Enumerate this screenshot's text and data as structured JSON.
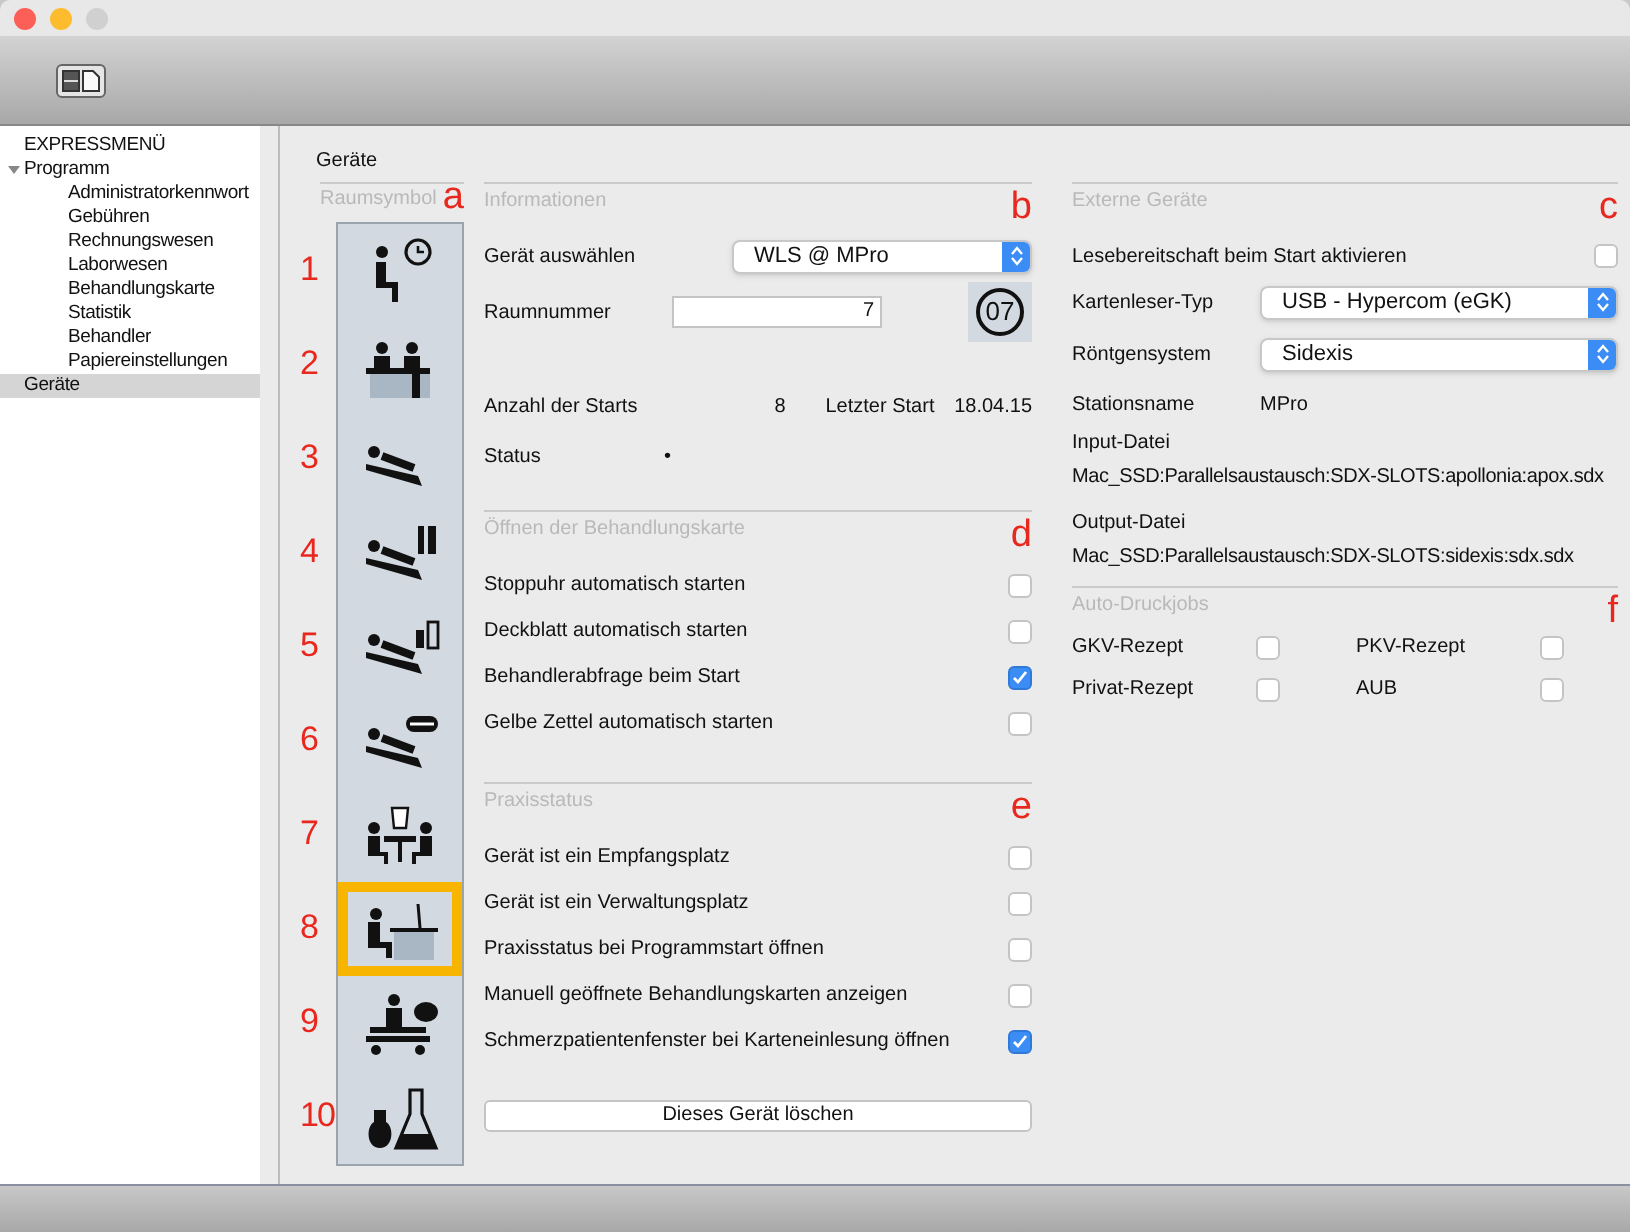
{
  "sidebar": {
    "items": [
      {
        "label": "EXPRESSMENÜ",
        "selected": false
      },
      {
        "label": "Programm",
        "selected": false,
        "expanded": true,
        "children": [
          {
            "label": "Administratorkennwort",
            "selected": false
          },
          {
            "label": "Gebühren",
            "selected": false
          },
          {
            "label": "Rechnungswesen",
            "selected": false
          },
          {
            "label": "Laborwesen",
            "selected": false
          },
          {
            "label": "Behandlungskarte",
            "selected": false
          },
          {
            "label": "Statistik",
            "selected": false
          },
          {
            "label": "Behandler",
            "selected": false
          },
          {
            "label": "Papiereinstellungen",
            "selected": false
          }
        ]
      },
      {
        "label": "Geräte",
        "selected": true
      }
    ]
  },
  "page_title": "Geräte",
  "room_symbols": {
    "title": "Raumsymbol",
    "marker": "a",
    "items": [
      {
        "number": "1",
        "selected": false
      },
      {
        "number": "2",
        "selected": false
      },
      {
        "number": "3",
        "selected": false
      },
      {
        "number": "4",
        "selected": false
      },
      {
        "number": "5",
        "selected": false
      },
      {
        "number": "6",
        "selected": false
      },
      {
        "number": "7",
        "selected": false
      },
      {
        "number": "8",
        "selected": true
      },
      {
        "number": "9",
        "selected": false
      },
      {
        "number": "10",
        "selected": false
      }
    ]
  },
  "informationen": {
    "title": "Informationen",
    "marker": "b",
    "device_label": "Gerät auswählen",
    "device_value": "WLS @ MPro",
    "room_label": "Raumnummer",
    "room_value": "7",
    "room_badge": "07",
    "starts_label": "Anzahl der Starts",
    "starts_value": "8",
    "last_label": "Letzter Start",
    "last_value": "18.04.15",
    "status_label": "Status",
    "status_value": "•"
  },
  "behandlungskarte": {
    "title": "Öffnen der Behandlungskarte",
    "marker": "d",
    "options": [
      {
        "label": "Stoppuhr automatisch starten",
        "checked": false
      },
      {
        "label": "Deckblatt automatisch starten",
        "checked": false
      },
      {
        "label": "Behandlerabfrage beim Start",
        "checked": true
      },
      {
        "label": "Gelbe Zettel automatisch starten",
        "checked": false
      }
    ]
  },
  "praxisstatus": {
    "title": "Praxisstatus",
    "marker": "e",
    "options": [
      {
        "label": "Gerät ist ein Empfangsplatz",
        "checked": false
      },
      {
        "label": "Gerät ist ein Verwaltungsplatz",
        "checked": false
      },
      {
        "label": "Praxisstatus bei Programmstart öffnen",
        "checked": false
      },
      {
        "label": "Manuell geöffnete Behandlungskarten anzeigen",
        "checked": false
      },
      {
        "label": "Schmerzpatientenfenster bei Karteneinlesung öffnen",
        "checked": true
      }
    ]
  },
  "delete_button": "Dieses Gerät löschen",
  "externe_geraete": {
    "title": "Externe Geräte",
    "marker": "c",
    "ready_label": "Lesebereitschaft beim Start aktivieren",
    "ready_checked": false,
    "reader_label": "Kartenleser-Typ",
    "reader_value": "USB - Hypercom (eGK)",
    "xray_label": "Röntgensystem",
    "xray_value": "Sidexis",
    "station_label": "Stationsname",
    "station_value": "MPro",
    "input_label": "Input-Datei",
    "input_value": "Mac_SSD:Parallelsaustausch:SDX-SLOTS:apollonia:apox.sdx",
    "output_label": "Output-Datei",
    "output_value": "Mac_SSD:Parallelsaustausch:SDX-SLOTS:sidexis:sdx.sdx"
  },
  "auto_druckjobs": {
    "title": "Auto-Druckjobs",
    "marker": "f",
    "options": [
      {
        "label": "GKV-Rezept",
        "checked": false
      },
      {
        "label": "PKV-Rezept",
        "checked": false
      },
      {
        "label": "Privat-Rezept",
        "checked": false
      },
      {
        "label": "AUB",
        "checked": false
      }
    ]
  }
}
